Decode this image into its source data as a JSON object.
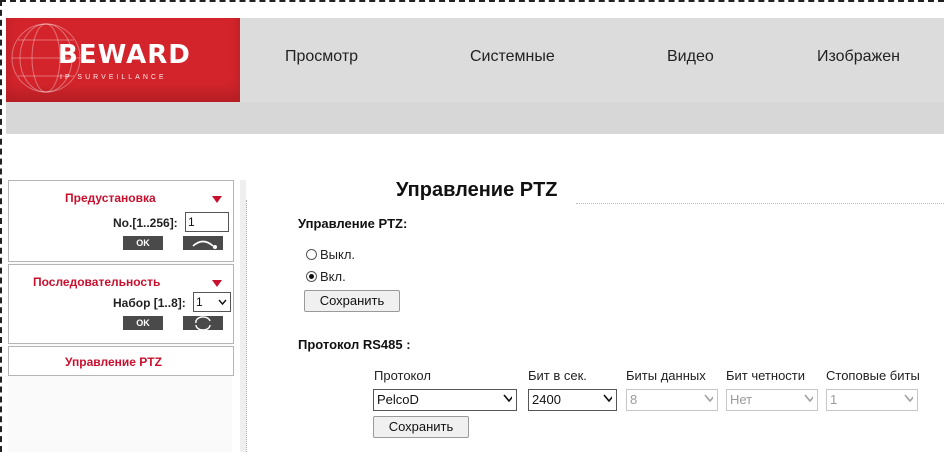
{
  "brand": {
    "name": "BEWARD",
    "tagline": "IP SURVEILLANCE",
    "accent": "#d4242b"
  },
  "nav": {
    "items": [
      "Просмотр",
      "Системные",
      "Видео",
      "Изображен"
    ]
  },
  "sidebar": {
    "preset": {
      "title": "Предустановка",
      "no_label": "No.[1..256]:",
      "no_value": "1",
      "ok_label": "OK"
    },
    "sequence": {
      "title": "Последовательность",
      "set_label": "Набор [1..8]:",
      "set_value": "1",
      "ok_label": "OK"
    },
    "ptz_link": "Управление PTZ"
  },
  "main": {
    "title": "Управление PTZ",
    "ptz_control": {
      "label": "Управление PTZ:",
      "options": [
        {
          "label": "Выкл.",
          "checked": false
        },
        {
          "label": "Вкл.",
          "checked": true
        }
      ],
      "save_label": "Сохранить"
    },
    "rs485": {
      "label": "Протокол RS485 :",
      "headers": [
        "Протокол",
        "Бит в сек.",
        "Биты данных",
        "Бит четности",
        "Стоповые биты"
      ],
      "values": {
        "protocol": "PelcoD",
        "baud": "2400",
        "data_bits": "8",
        "parity": "Нет",
        "stop_bits": "1"
      },
      "save_label": "Сохранить"
    }
  }
}
